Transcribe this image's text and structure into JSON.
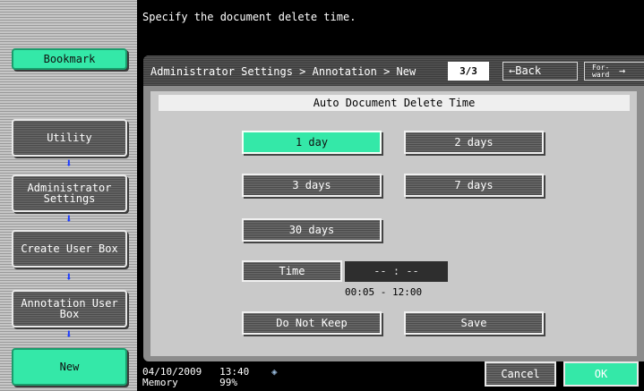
{
  "message": "Specify the document delete time.",
  "sidebar": {
    "bookmark": "Bookmark",
    "items": [
      {
        "label": "Utility"
      },
      {
        "label": "Administrator Settings"
      },
      {
        "label": "Create User Box"
      },
      {
        "label": "Annotation User Box"
      },
      {
        "label": "New"
      }
    ]
  },
  "header": {
    "breadcrumb": "Administrator Settings > Annotation > New",
    "page": "3/3",
    "back_label": "Back",
    "forward_label": "For-ward"
  },
  "section_title": "Auto Document Delete Time",
  "options": [
    {
      "label": "1 day",
      "selected": true
    },
    {
      "label": "2 days",
      "selected": false
    },
    {
      "label": "3 days",
      "selected": false
    },
    {
      "label": "7 days",
      "selected": false
    },
    {
      "label": "30 days",
      "selected": false
    }
  ],
  "time": {
    "button_label": "Time",
    "display": "-- : --",
    "range": "00:05  -  12:00"
  },
  "actions": {
    "do_not_keep": "Do Not Keep",
    "save": "Save"
  },
  "footer": {
    "date": "04/10/2009",
    "time": "13:40",
    "memory_label": "Memory",
    "memory_value": "99%",
    "cancel": "Cancel",
    "ok": "OK"
  },
  "colors": {
    "accent_green": "#34e8a8",
    "arrow_blue": "#1d3cff"
  }
}
